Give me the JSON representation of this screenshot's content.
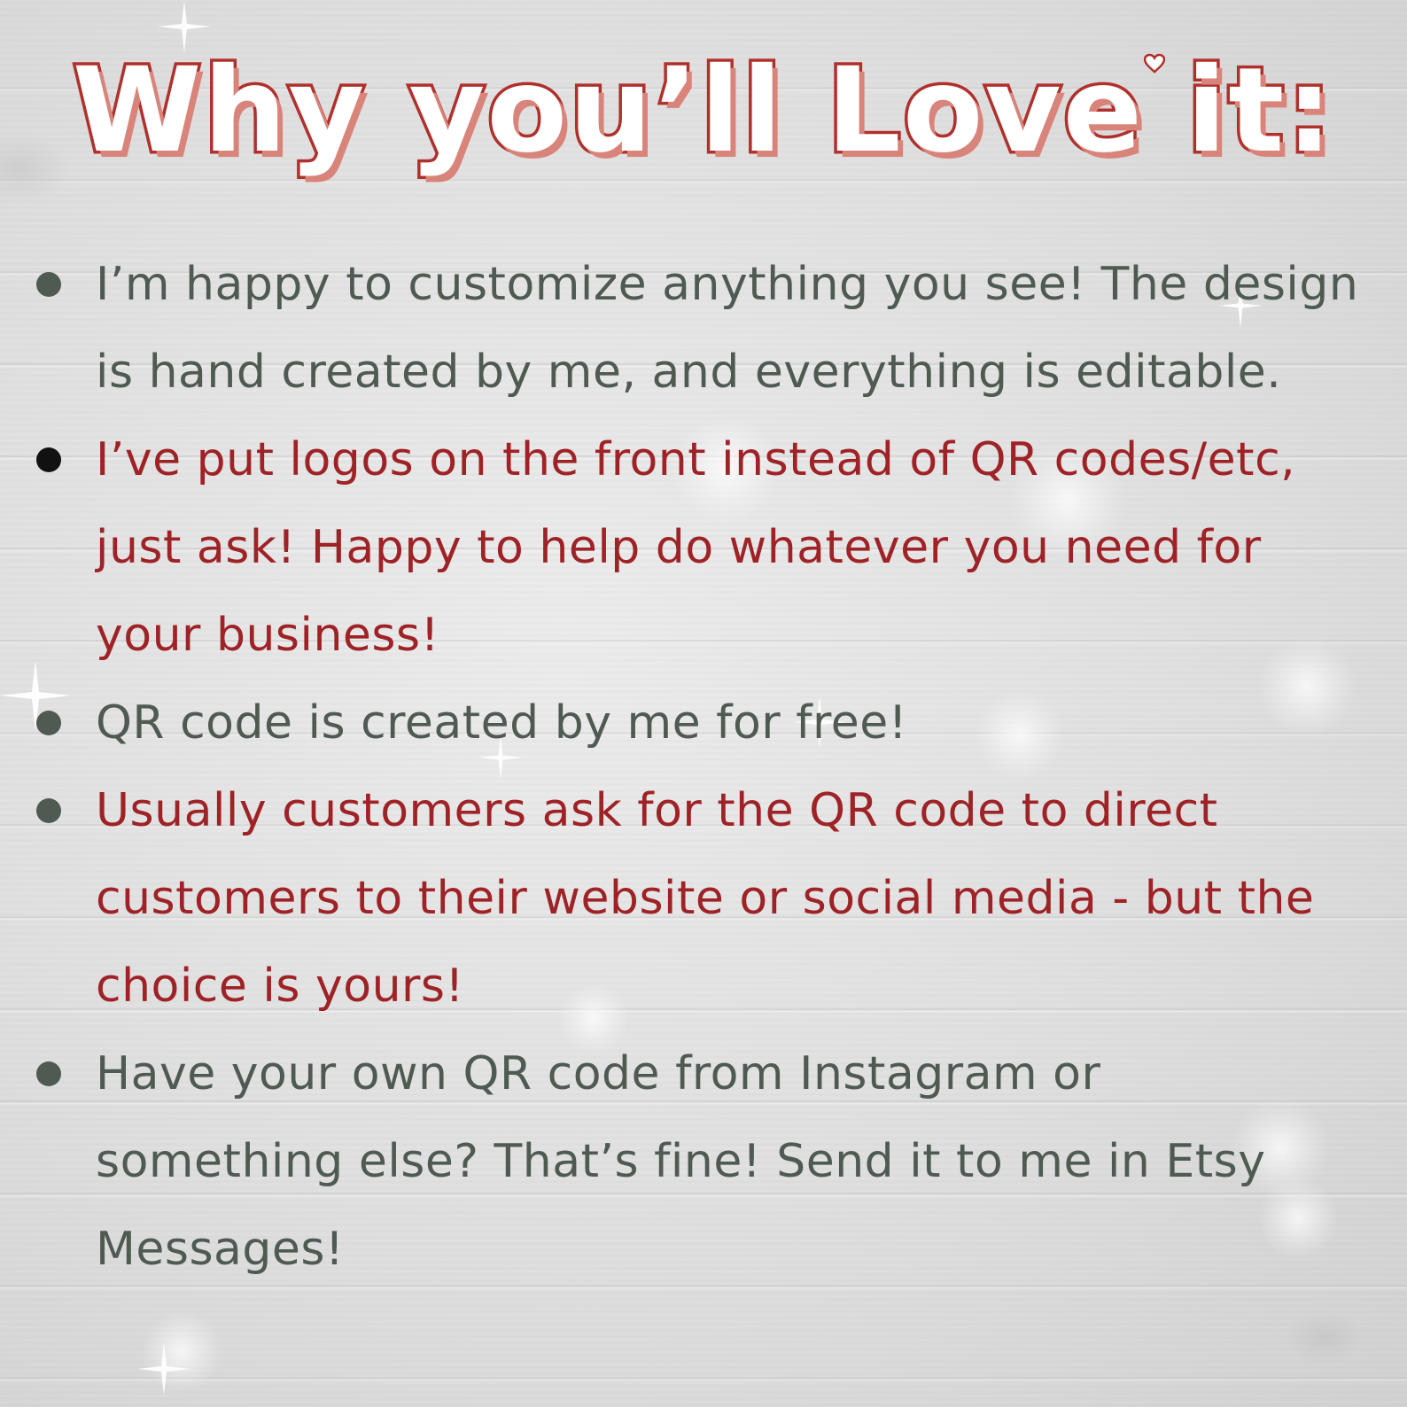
{
  "title": "Why you’ll Love it:",
  "colors": {
    "title_outline": "#b0302c",
    "title_shadow": "#d9847a",
    "text_gray": "#4f5a52",
    "text_red": "#9e2226",
    "bullet_gray": "#4f5a52",
    "bullet_black": "#111111",
    "background": "#dcdcdc"
  },
  "bullets": [
    {
      "text": "I’m happy to customize anything you see! The design is hand created by me, and everything is editable.",
      "color": "gray",
      "bullet_color": "#4f5a52"
    },
    {
      "text": "I’ve put logos on the front instead of QR codes/etc, just ask! Happy to help do whatever you need for your business!",
      "color": "red",
      "bullet_color": "#111111"
    },
    {
      "text": "QR code is created by me for free!",
      "color": "gray",
      "bullet_color": "#4f5a52"
    },
    {
      "text": "Usually customers ask for the QR code to direct customers to their website or social media - but the choice is yours!",
      "color": "red",
      "bullet_color": "#4f5a52"
    },
    {
      "text": "Have your own QR code from Instagram or something else? That’s fine! Send it to me in Etsy Messages!",
      "color": "gray",
      "bullet_color": "#4f5a52"
    }
  ]
}
